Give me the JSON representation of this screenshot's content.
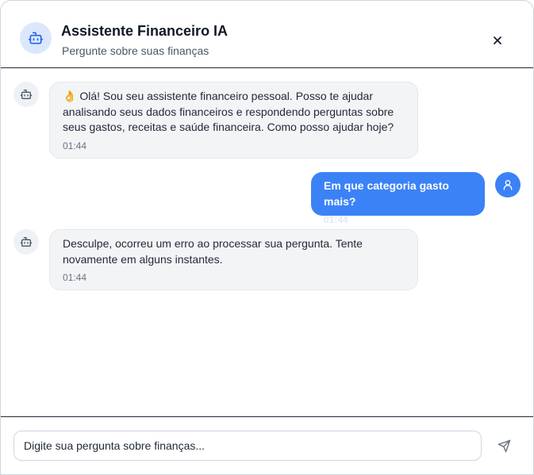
{
  "header": {
    "title": "Assistente Financeiro IA",
    "subtitle": "Pergunte sobre suas finanças",
    "avatar_icon": "bot-icon",
    "close_icon": "close-icon"
  },
  "messages": [
    {
      "role": "assistant",
      "text": "👌 Olá! Sou seu assistente financeiro pessoal. Posso te ajudar analisando seus dados financeiros e respondendo perguntas sobre seus gastos, receitas e saúde financeira. Como posso ajudar hoje?",
      "time": "01:44"
    },
    {
      "role": "user",
      "text": "Em que categoria gasto mais?",
      "time": "01:44"
    },
    {
      "role": "assistant",
      "text": "Desculpe, ocorreu um erro ao processar sua pergunta. Tente novamente em alguns instantes.",
      "time": "01:44"
    }
  ],
  "input": {
    "placeholder": "Digite sua pergunta sobre finanças...",
    "value": "",
    "send_icon": "send-icon"
  },
  "colors": {
    "accent": "#3b82f6",
    "bot_bubble": "#f3f4f6",
    "avatar_bg": "#dbe8fb"
  }
}
